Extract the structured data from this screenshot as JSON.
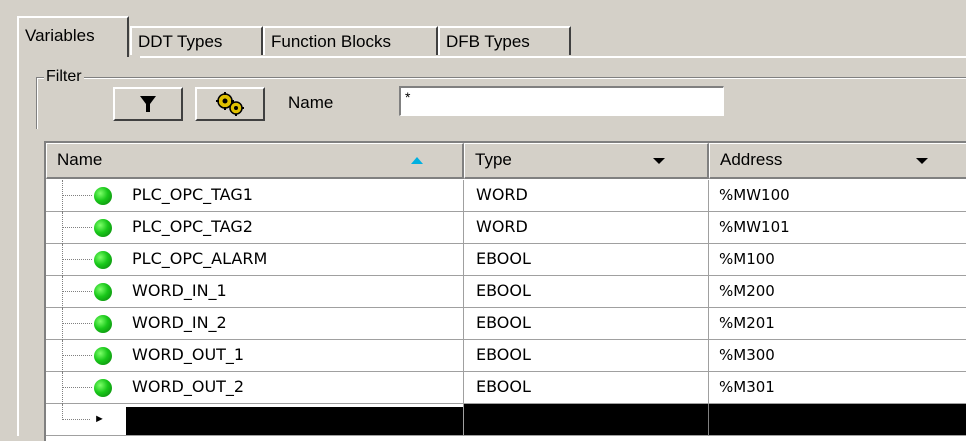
{
  "tabs": [
    {
      "label": "Variables",
      "active": true
    },
    {
      "label": "DDT Types",
      "active": false
    },
    {
      "label": "Function Blocks",
      "active": false
    },
    {
      "label": "DFB Types",
      "active": false
    }
  ],
  "filter": {
    "legend": "Filter",
    "name_label": "Name",
    "name_value": "*",
    "funnel_icon": "funnel-icon",
    "settings_icon": "gear-icon"
  },
  "grid": {
    "columns": [
      {
        "label": "Name",
        "sort": "ascending"
      },
      {
        "label": "Type"
      },
      {
        "label": "Address"
      }
    ],
    "rows": [
      {
        "name": "PLC_OPC_TAG1",
        "type": "WORD",
        "address": "%MW100"
      },
      {
        "name": "PLC_OPC_TAG2",
        "type": "WORD",
        "address": "%MW101"
      },
      {
        "name": "PLC_OPC_ALARM",
        "type": "EBOOL",
        "address": "%M100"
      },
      {
        "name": "WORD_IN_1",
        "type": "EBOOL",
        "address": "%M200"
      },
      {
        "name": "WORD_IN_2",
        "type": "EBOOL",
        "address": "%M201"
      },
      {
        "name": "WORD_OUT_1",
        "type": "EBOOL",
        "address": "%M300"
      },
      {
        "name": "WORD_OUT_2",
        "type": "EBOOL",
        "address": "%M301"
      }
    ]
  },
  "colors": {
    "status_ok": "#19c81a",
    "face": "#d4d0c8"
  }
}
